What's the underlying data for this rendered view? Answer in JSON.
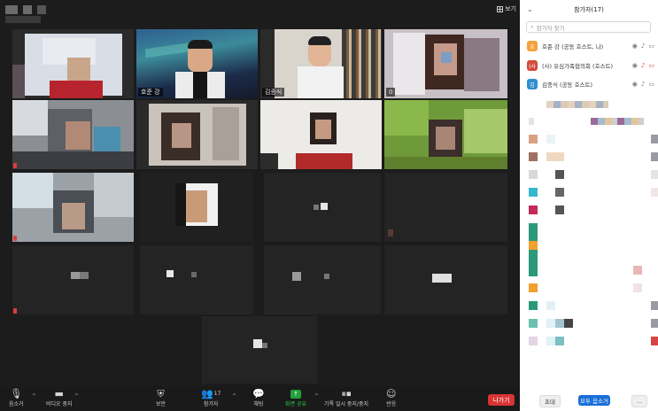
{
  "header": {
    "view_label": "보기"
  },
  "tiles": [
    {
      "name": ""
    },
    {
      "name": "호준 강"
    },
    {
      "name": "김종식"
    },
    {
      "name": "0"
    }
  ],
  "toolbar": {
    "audio": "음소거",
    "video": "비디오 중지",
    "security": "보안",
    "participants": "참가자",
    "participants_count": "17",
    "chat": "채팅",
    "share": "화면 공유",
    "record": "기록 일시 중지/중지",
    "reactions": "반응",
    "leave": "나가기"
  },
  "panel": {
    "title": "참가자(17)",
    "search_placeholder": "참가자 찾기",
    "participants": [
      {
        "avatar": "호",
        "name": "호준 강 (공동 호스트, 나)",
        "color": "#f2a23a"
      },
      {
        "avatar": "(사",
        "name": "(사) 유심가족협의회 (호스트)",
        "color": "#d24a3a"
      },
      {
        "avatar": "김",
        "name": "김종식 (공동 호스트)",
        "color": "#2f8fd0"
      }
    ],
    "invite": "초대",
    "mute_all": "모두 음소거",
    "more": "..."
  }
}
